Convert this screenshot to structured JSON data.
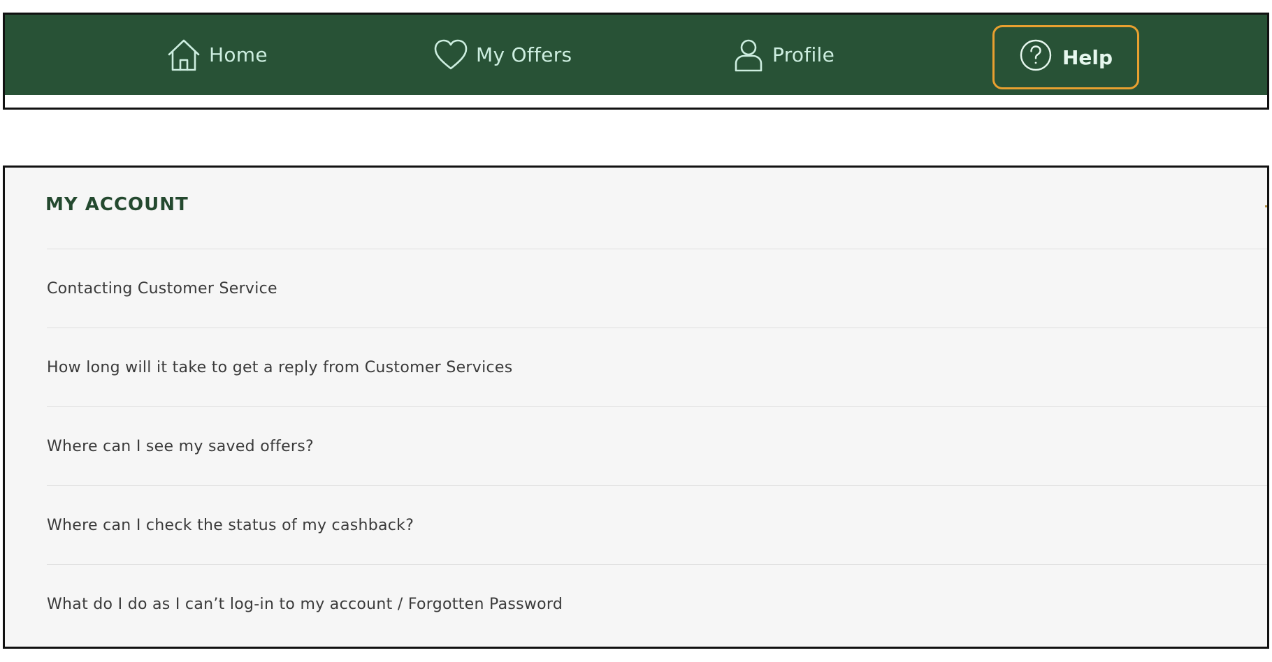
{
  "nav": {
    "items": [
      {
        "label": "Home",
        "icon": "home-icon"
      },
      {
        "label": "My Offers",
        "icon": "heart-icon"
      },
      {
        "label": "Profile",
        "icon": "user-icon"
      }
    ],
    "help": {
      "label": "Help",
      "icon": "question-circle-icon",
      "state": "focused"
    }
  },
  "faq": {
    "title": "MY ACCOUNT",
    "items": [
      "Contacting Customer Service",
      "How long will it take to get a reply from Customer Services",
      "Where can I see my saved offers?",
      "Where can I check the status of my cashback?",
      "What do I do as I can’t log-in to my account / Forgotten Password"
    ]
  },
  "colors": {
    "nav_background": "#285236",
    "nav_text": "#cdeee0",
    "focus_ring": "#e8a030",
    "heading": "#24492f",
    "panel_background": "#f6f6f6"
  }
}
